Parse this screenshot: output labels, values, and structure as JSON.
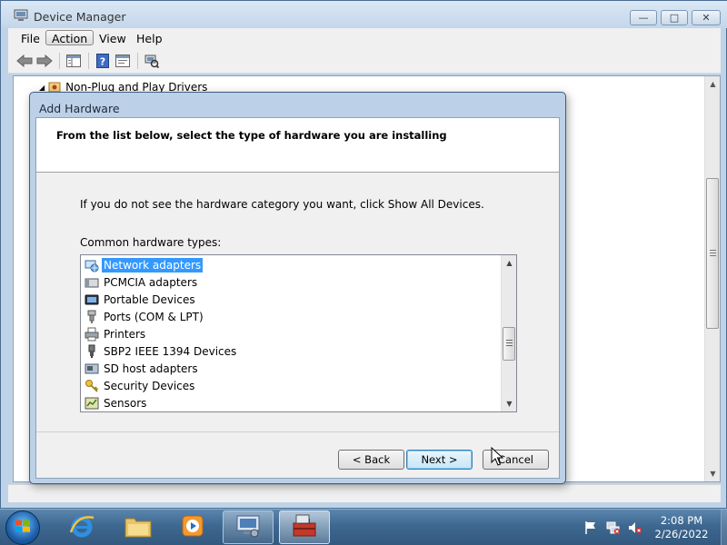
{
  "window": {
    "title": "Device Manager",
    "minimize": "—",
    "maximize": "□",
    "close": "✕"
  },
  "menu": {
    "file": "File",
    "action": "Action",
    "view": "View",
    "help": "Help"
  },
  "toolbar": {
    "icons": [
      "back-arrow-icon",
      "forward-arrow-icon",
      "show-hide-console-tree-icon",
      "help-icon",
      "properties-icon",
      "scan-hardware-icon"
    ]
  },
  "tree": {
    "visible_node": "Non-Plug and Play Drivers"
  },
  "dialog": {
    "title": "Add Hardware",
    "heading": "From the list below, select the type of hardware you are installing",
    "instruction": "If you do not see the hardware category you want, click Show All Devices.",
    "list_label": "Common hardware types:",
    "items": [
      {
        "label": "Network adapters",
        "icon": "network-adapter-icon",
        "selected": true
      },
      {
        "label": "PCMCIA adapters",
        "icon": "pcmcia-icon",
        "selected": false
      },
      {
        "label": "Portable Devices",
        "icon": "portable-device-icon",
        "selected": false
      },
      {
        "label": "Ports (COM & LPT)",
        "icon": "port-icon",
        "selected": false
      },
      {
        "label": "Printers",
        "icon": "printer-icon",
        "selected": false
      },
      {
        "label": "SBP2 IEEE 1394 Devices",
        "icon": "ieee1394-icon",
        "selected": false
      },
      {
        "label": "SD host adapters",
        "icon": "sd-host-icon",
        "selected": false
      },
      {
        "label": "Security Devices",
        "icon": "security-device-icon",
        "selected": false
      },
      {
        "label": "Sensors",
        "icon": "sensor-icon",
        "selected": false
      }
    ],
    "buttons": {
      "back": "< Back",
      "next": "Next >",
      "cancel": "Cancel"
    }
  },
  "taskbar": {
    "pinned": [
      "start-orb",
      "internet-explorer-icon",
      "windows-explorer-icon",
      "media-player-icon",
      "device-manager-app-icon",
      "add-hardware-app-icon"
    ],
    "clock_time": "2:08 PM",
    "clock_date": "2/26/2022"
  },
  "colors": {
    "selection": "#3399ff",
    "taskbar": "#3e6890",
    "window_frame": "#bfd3e8"
  }
}
